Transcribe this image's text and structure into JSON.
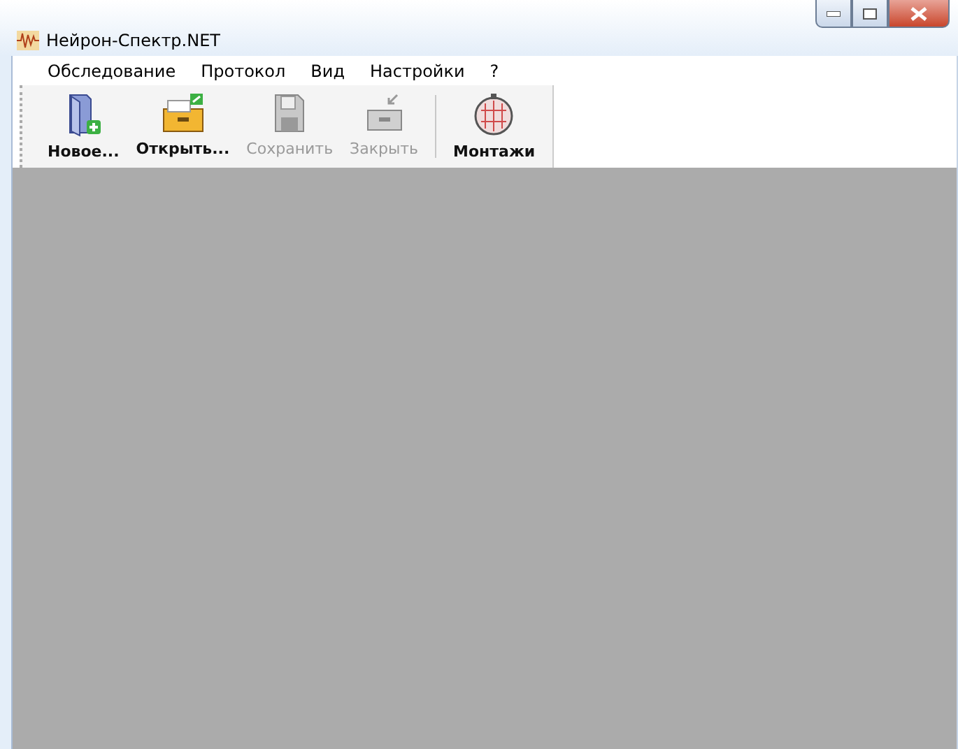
{
  "window": {
    "title": "Нейрон-Спектр.NET"
  },
  "menu": [
    "Обследование",
    "Протокол",
    "Вид",
    "Настройки",
    "?"
  ],
  "toolbar": [
    {
      "label": "Новое...",
      "kind": "new",
      "disabled": false,
      "separator_before": false
    },
    {
      "label": "Открыть...",
      "kind": "open",
      "disabled": false,
      "separator_before": false
    },
    {
      "label": "Сохранить",
      "kind": "save",
      "disabled": true,
      "separator_before": false
    },
    {
      "label": "Закрыть",
      "kind": "close",
      "disabled": true,
      "separator_before": false
    },
    {
      "label": "Монтажи",
      "kind": "montage",
      "disabled": false,
      "separator_before": true
    }
  ]
}
